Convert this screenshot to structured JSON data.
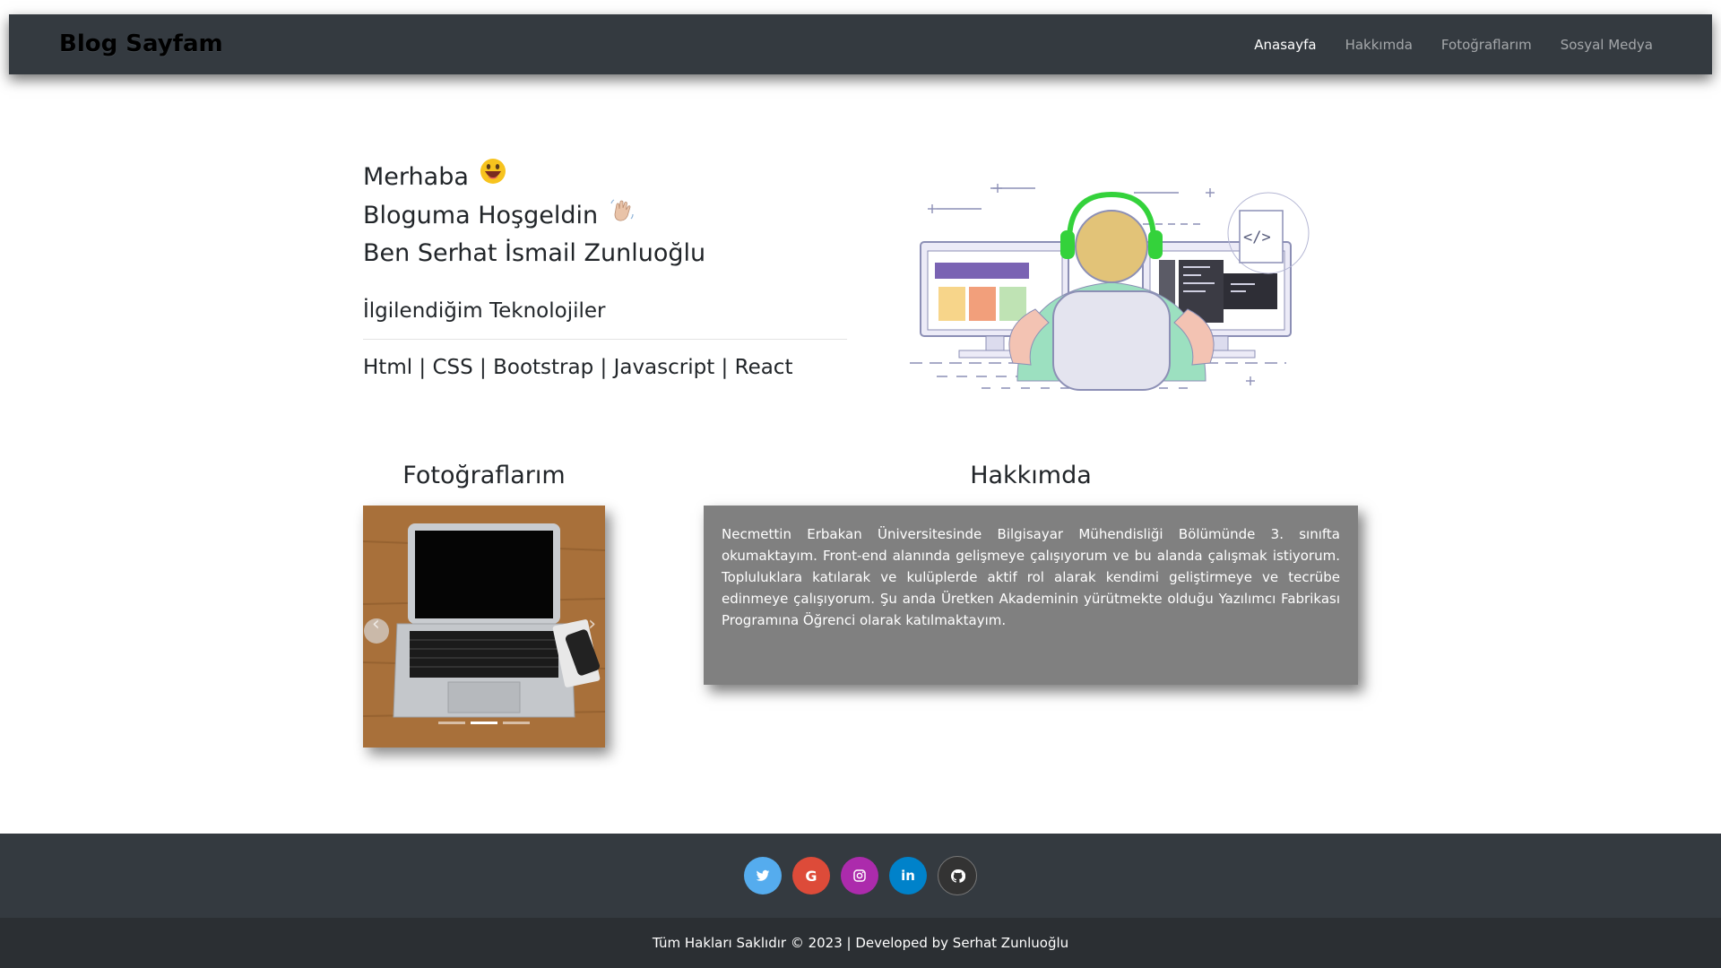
{
  "navbar": {
    "brand": "Blog Sayfam",
    "links": [
      {
        "label": "Anasayfa",
        "active": true
      },
      {
        "label": "Hakkımda",
        "active": false
      },
      {
        "label": "Fotoğraflarım",
        "active": false
      },
      {
        "label": "Sosyal Medya",
        "active": false
      }
    ]
  },
  "hero": {
    "line1": "Merhaba",
    "line2": "Bloguma Hoşgeldin",
    "line3": "Ben Serhat İsmail Zunluoğlu",
    "tech_title": "İlgilendiğim Teknolojiler",
    "tech_list": "Html | CSS | Bootstrap | Javascript | React"
  },
  "photos": {
    "title": "Fotoğraflarım",
    "active_slide": 2,
    "slide_count": 3
  },
  "about": {
    "title": "Hakkımda",
    "text": "Necmettin Erbakan Üniversitesinde Bilgisayar Mühendisliği Bölümünde 3. sınıfta okumaktayım. Front-end alanında gelişmeye çalışıyorum ve bu alanda çalışmak istiyorum. Topluluklara katılarak ve kulüplerde aktif rol alarak kendimi geliştirmeye ve tecrübe edinmeye çalışıyorum. Şu anda Üretken Akademinin yürütmekte olduğu Yazılımcı Fabrikası Programına Öğrenci olarak katılmaktayım."
  },
  "social": [
    {
      "name": "twitter",
      "icon": "twitter-icon",
      "color": "#55acee"
    },
    {
      "name": "google",
      "icon": "google-icon",
      "color": "#dd4b39"
    },
    {
      "name": "instagram",
      "icon": "instagram-icon",
      "color": "#ac2bac"
    },
    {
      "name": "linkedin",
      "icon": "linkedin-icon",
      "color": "#0082ca"
    },
    {
      "name": "github",
      "icon": "github-icon",
      "color": "#333333"
    }
  ],
  "footer": {
    "copyright": "Tüm Hakları Saklıdır © 2023 | Developed by Serhat Zunluoğlu"
  }
}
